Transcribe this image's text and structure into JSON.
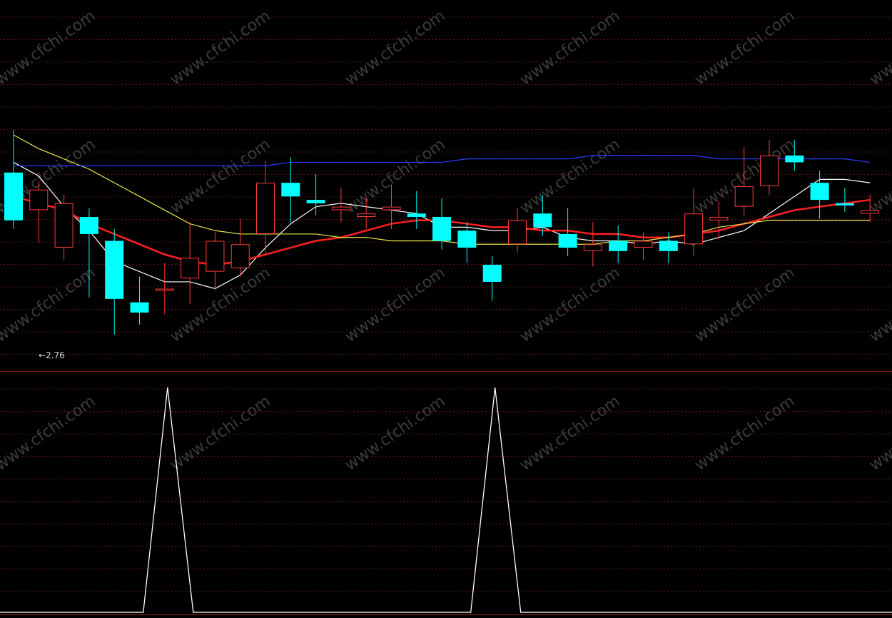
{
  "chart_data": [
    {
      "type": "candlestick",
      "price_range": [
        2.7,
        3.4
      ],
      "low_marker_text": "2.76",
      "candles": [
        {
          "o": 3.25,
          "h": 3.35,
          "l": 3.2,
          "c": 3.11,
          "color": "cyan"
        },
        {
          "o": 3.2,
          "h": 3.19,
          "l": 3.07,
          "c": 3.14,
          "color": "red"
        },
        {
          "o": 3.16,
          "h": 3.02,
          "l": 3.12,
          "c": 3.03,
          "color": "red"
        },
        {
          "o": 3.12,
          "h": 2.91,
          "l": 3.08,
          "c": 3.07,
          "color": "cyan"
        },
        {
          "o": 3.05,
          "h": 3.06,
          "l": 2.8,
          "c": 2.88,
          "color": "cyan"
        },
        {
          "o": 2.87,
          "h": 2.92,
          "l": 2.83,
          "c": 2.84,
          "color": "cyan"
        },
        {
          "o": 2.91,
          "h": 2.96,
          "l": 2.86,
          "c": 2.91,
          "color": "red"
        },
        {
          "o": 2.94,
          "h": 3.08,
          "l": 2.89,
          "c": 3.0,
          "color": "red"
        },
        {
          "o": 2.96,
          "h": 3.05,
          "l": 2.93,
          "c": 3.05,
          "color": "red"
        },
        {
          "o": 2.97,
          "h": 3.09,
          "l": 2.99,
          "c": 3.04,
          "color": "red"
        },
        {
          "o": 3.07,
          "h": 3.26,
          "l": 3.04,
          "c": 3.22,
          "color": "red"
        },
        {
          "o": 3.22,
          "h": 3.27,
          "l": 3.13,
          "c": 3.18,
          "color": "cyan"
        },
        {
          "o": 3.17,
          "h": 3.22,
          "l": 3.15,
          "c": 3.16,
          "color": "cyan"
        },
        {
          "o": 3.15,
          "h": 3.18,
          "l": 3.13,
          "c": 3.14,
          "color": "red"
        },
        {
          "o": 3.13,
          "h": 3.15,
          "l": 3.11,
          "c": 3.12,
          "color": "red"
        },
        {
          "o": 3.14,
          "h": 3.19,
          "l": 3.11,
          "c": 3.15,
          "color": "red"
        },
        {
          "o": 3.13,
          "h": 3.17,
          "l": 3.11,
          "c": 3.12,
          "color": "cyan"
        },
        {
          "o": 3.12,
          "h": 3.15,
          "l": 3.05,
          "c": 3.05,
          "color": "cyan"
        },
        {
          "o": 3.08,
          "h": 3.08,
          "l": 3.01,
          "c": 3.03,
          "color": "cyan"
        },
        {
          "o": 2.98,
          "h": 2.95,
          "l": 2.9,
          "c": 2.93,
          "color": "cyan"
        },
        {
          "o": 3.04,
          "h": 3.12,
          "l": 3.04,
          "c": 3.11,
          "color": "red"
        },
        {
          "o": 3.13,
          "h": 3.16,
          "l": 3.09,
          "c": 3.09,
          "color": "cyan"
        },
        {
          "o": 3.07,
          "h": 3.12,
          "l": 3.03,
          "c": 3.03,
          "color": "cyan"
        },
        {
          "o": 3.02,
          "h": 3.08,
          "l": 3.0,
          "c": 3.04,
          "color": "red"
        },
        {
          "o": 3.05,
          "h": 3.07,
          "l": 3.01,
          "c": 3.02,
          "color": "cyan"
        },
        {
          "o": 3.03,
          "h": 3.05,
          "l": 3.02,
          "c": 3.05,
          "color": "red"
        },
        {
          "o": 3.05,
          "h": 3.01,
          "l": 3.02,
          "c": 3.02,
          "color": "cyan"
        },
        {
          "o": 3.04,
          "h": 3.18,
          "l": 3.03,
          "c": 3.13,
          "color": "red"
        },
        {
          "o": 3.11,
          "h": 3.14,
          "l": 3.08,
          "c": 3.12,
          "color": "red"
        },
        {
          "o": 3.15,
          "h": 3.3,
          "l": 3.17,
          "c": 3.21,
          "color": "red"
        },
        {
          "o": 3.21,
          "h": 3.32,
          "l": 3.27,
          "c": 3.3,
          "color": "red"
        },
        {
          "o": 3.28,
          "h": 3.32,
          "l": 3.29,
          "c": 3.3,
          "color": "cyan"
        },
        {
          "o": 3.22,
          "h": 3.23,
          "l": 3.14,
          "c": 3.17,
          "color": "cyan"
        },
        {
          "o": 3.16,
          "h": 3.18,
          "l": 3.16,
          "c": 3.16,
          "color": "cyan"
        },
        {
          "o": 3.14,
          "h": 3.16,
          "l": 3.13,
          "c": 3.13,
          "color": "red"
        }
      ],
      "ma_lines": [
        {
          "color": "#ffffff",
          "values": [
            3.28,
            3.24,
            3.15,
            3.08,
            2.99,
            2.96,
            2.93,
            2.93,
            2.91,
            2.95,
            3.03,
            3.1,
            3.15,
            3.16,
            3.15,
            3.14,
            3.13,
            3.09,
            3.09,
            3.08,
            3.08,
            3.09,
            3.06,
            3.05,
            3.05,
            3.04,
            3.05,
            3.04,
            3.06,
            3.08,
            3.13,
            3.18,
            3.23,
            3.23,
            3.22
          ]
        },
        {
          "color": "#ff2020",
          "values": [
            3.18,
            3.16,
            3.14,
            3.1,
            3.07,
            3.04,
            3.01,
            2.99,
            2.98,
            2.99,
            3.01,
            3.03,
            3.05,
            3.06,
            3.08,
            3.1,
            3.11,
            3.11,
            3.1,
            3.09,
            3.09,
            3.08,
            3.08,
            3.07,
            3.07,
            3.06,
            3.06,
            3.07,
            3.08,
            3.1,
            3.12,
            3.14,
            3.15,
            3.16,
            3.17
          ]
        },
        {
          "color": "#e8e84a",
          "values": [
            3.36,
            3.32,
            3.29,
            3.26,
            3.22,
            3.18,
            3.14,
            3.1,
            3.08,
            3.07,
            3.07,
            3.07,
            3.07,
            3.06,
            3.06,
            3.05,
            3.05,
            3.05,
            3.04,
            3.04,
            3.04,
            3.04,
            3.04,
            3.04,
            3.05,
            3.05,
            3.06,
            3.07,
            3.09,
            3.1,
            3.11,
            3.11,
            3.11,
            3.11,
            3.11
          ]
        },
        {
          "color": "#2b3bff",
          "values": [
            3.27,
            3.27,
            3.27,
            3.27,
            3.27,
            3.27,
            3.27,
            3.27,
            3.27,
            3.27,
            3.27,
            3.28,
            3.28,
            3.28,
            3.28,
            3.28,
            3.28,
            3.28,
            3.29,
            3.29,
            3.29,
            3.29,
            3.29,
            3.3,
            3.3,
            3.3,
            3.3,
            3.3,
            3.29,
            3.29,
            3.29,
            3.29,
            3.29,
            3.29,
            3.28
          ]
        }
      ]
    },
    {
      "type": "line",
      "color": "#ffffff",
      "y_range": [
        0,
        1
      ],
      "values": [
        0,
        0,
        0,
        0,
        0,
        0,
        1,
        0,
        0,
        0,
        0,
        0,
        0,
        0,
        0,
        0,
        0,
        0,
        0,
        1,
        0,
        0,
        0,
        0,
        0,
        0,
        0,
        0,
        0,
        0,
        0,
        0,
        0,
        0,
        0
      ]
    }
  ],
  "watermark": "www.cfchi.com"
}
